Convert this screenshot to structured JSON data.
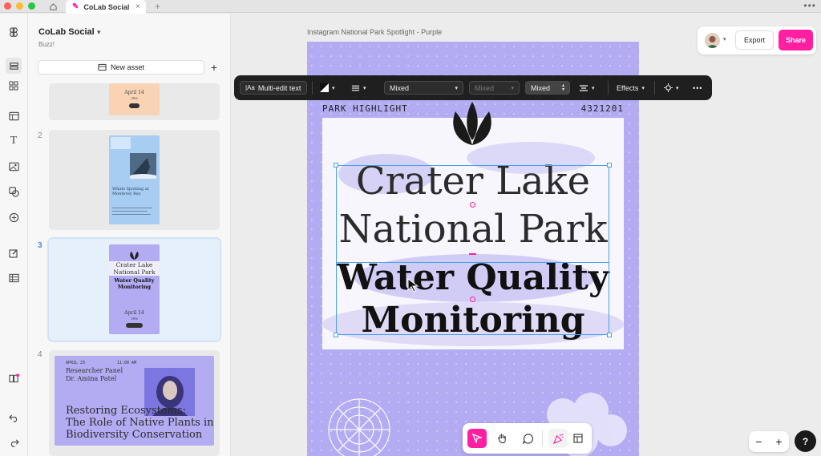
{
  "window": {
    "tab_title": "CoLab Social",
    "tab_close": "×",
    "new_tab": "+",
    "more": "•••"
  },
  "sidebar": {
    "project_name": "CoLab Social",
    "project_subtitle": "Buzz!",
    "new_asset_label": "New asset",
    "add_label": "+",
    "slides": [
      {
        "number": "1",
        "date": "April 14",
        "sub": "2PM"
      },
      {
        "number": "2",
        "title": "Whale Spotting at Monterey Bay"
      },
      {
        "number": "3",
        "title_line1": "Crater Lake",
        "title_line2": "National Park",
        "title_line3": "Water Quality",
        "title_line4": "Monitoring",
        "date": "April 14",
        "sub": "2PM"
      },
      {
        "number": "4",
        "date": "APRIL 25",
        "time": "11:00 AM",
        "panel": "Researcher Panel",
        "speaker": "Dr. Amina Patel",
        "title_line1": "Restoring Ecosystems:",
        "title_line2": "The Role of Native Plants in",
        "title_line3": "Biodiversity Conservation"
      }
    ]
  },
  "canvas": {
    "doc_title": "Instagram National Park Spotlight - Purple",
    "poster": {
      "tag_left": "PARK HIGHLIGHT",
      "tag_right": "4321201",
      "line1": "Crater Lake",
      "line2": "National Park",
      "line3": "Water Quality",
      "line4": "Monitoring"
    }
  },
  "toolbar": {
    "multi_edit": "Multi-edit text",
    "font_family": "Mixed",
    "font_weight": "Mixed",
    "font_size": "Mixed",
    "effects": "Effects",
    "more": "•••"
  },
  "topright": {
    "export": "Export",
    "share": "Share"
  },
  "zoom": {
    "minus": "−",
    "plus": "+"
  },
  "help": "?",
  "colors": {
    "accent": "#ff1fa0",
    "poster_bg": "#b3acf3",
    "selection": "#4a9fe8"
  }
}
